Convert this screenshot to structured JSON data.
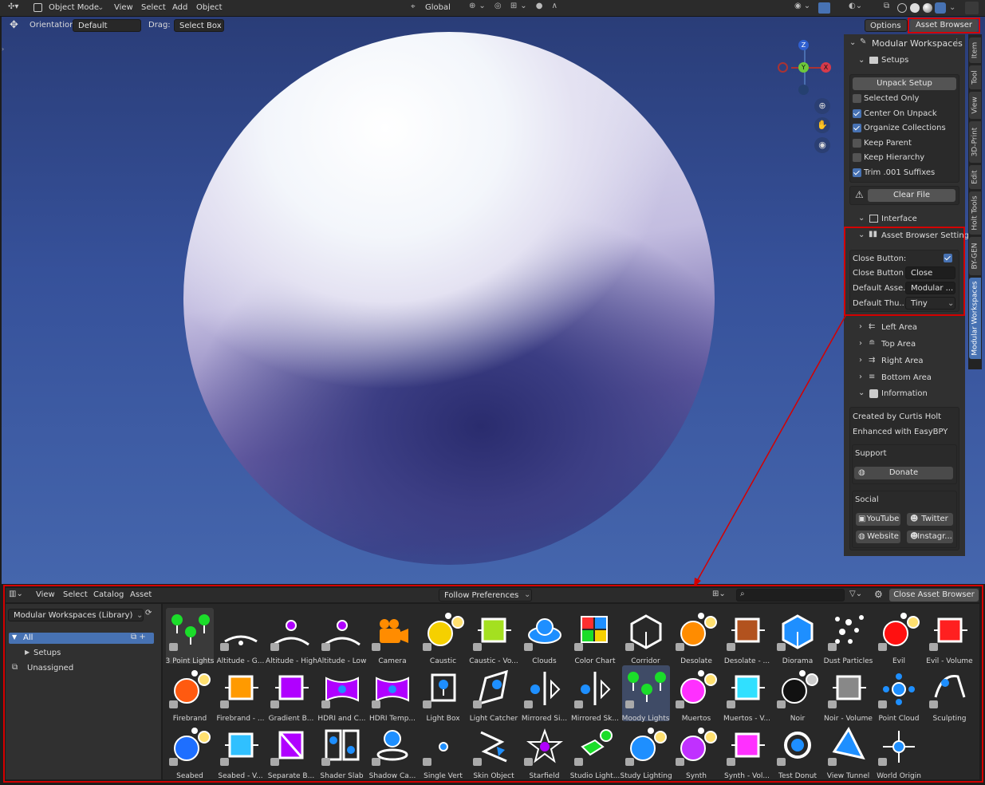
{
  "header": {
    "mode": "Object Mode",
    "menus": [
      "View",
      "Select",
      "Add",
      "Object"
    ],
    "transform": "Global"
  },
  "toolbar": {
    "orientation_label": "Orientation:",
    "orientation": "Default",
    "drag_label": "Drag:",
    "drag": "Select Box",
    "options": "Options",
    "asset_browser": "Asset Browser"
  },
  "gizmo": {
    "x": "X",
    "y": "Y",
    "z": "Z"
  },
  "panel": {
    "title": "Modular Workspaces",
    "setups": "Setups",
    "unpack": "Unpack Setup",
    "checks": [
      {
        "label": "Selected Only",
        "on": false
      },
      {
        "label": "Center On Unpack",
        "on": true
      },
      {
        "label": "Organize Collections",
        "on": true
      },
      {
        "label": "Keep Parent",
        "on": false
      },
      {
        "label": "Keep Hierarchy",
        "on": false
      },
      {
        "label": "Trim .001 Suffixes",
        "on": true
      }
    ],
    "clear": "Clear File",
    "interface": "Interface",
    "abs": "Asset Browser Settings",
    "close_button": "Close Button:",
    "close_button_text_label": "Close Button ...",
    "close_button_text": "Close Ass...",
    "default_asset_label": "Default Asse...",
    "default_asset": "Modular ...",
    "default_thumb_label": "Default Thu...",
    "default_thumb": "Tiny",
    "areas": [
      "Left Area",
      "Top Area",
      "Right Area",
      "Bottom Area"
    ],
    "information": "Information",
    "created": "Created by Curtis Holt",
    "enhanced": "Enhanced with EasyBPY",
    "support": "Support",
    "donate": "Donate",
    "social": "Social",
    "youtube": "YouTube",
    "twitter": "Twitter",
    "website": "Website",
    "instagram": "Instagr..."
  },
  "vtabs": [
    "Item",
    "Tool",
    "View",
    "3D-Print",
    "Edit",
    "Holt Tools",
    "BY-GEN",
    "Modular Workspaces"
  ],
  "browser": {
    "menus": [
      "View",
      "Select",
      "Catalog",
      "Asset"
    ],
    "prefs": "Follow Preferences",
    "close": "Close Asset Browser",
    "library": "Modular Workspaces (Library)",
    "tree": [
      "All",
      "Setups",
      "Unassigned"
    ],
    "assets": [
      "3 Point Lights",
      "Altitude - G...",
      "Altitude - High",
      "Altitude - Low",
      "Camera",
      "Caustic",
      "Caustic - Vo...",
      "Clouds",
      "Color Chart",
      "Corridor",
      "Desolate",
      "Desolate - ...",
      "Diorama",
      "Dust Particles",
      "Evil",
      "Evil - Volume",
      "Firebrand",
      "Firebrand - ...",
      "Gradient B...",
      "HDRI and C...",
      "HDRI Temp...",
      "Light Box",
      "Light Catcher",
      "Mirrored Si...",
      "Mirrored Sk...",
      "Moody Lights",
      "Muertos",
      "Muertos - V...",
      "Noir",
      "Noir - Volume",
      "Point Cloud",
      "Sculpting",
      "Seabed",
      "Seabed - V...",
      "Separate B...",
      "Shader Slab",
      "Shadow Ca...",
      "Single Vert",
      "Skin Object",
      "Starfield",
      "Studio Light...",
      "Study Lighting",
      "Synth",
      "Synth - Vol...",
      "Test Donut",
      "View Tunnel",
      "World Origin"
    ]
  }
}
